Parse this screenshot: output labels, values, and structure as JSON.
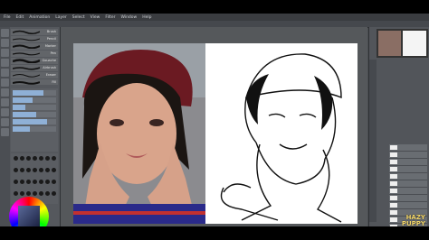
{
  "app": {
    "menu": [
      "File",
      "Edit",
      "Animation",
      "Layer",
      "Select",
      "View",
      "Filter",
      "Window",
      "Help"
    ]
  },
  "brushes": {
    "items": [
      "Brush",
      "Pencil",
      "Marker",
      "Pen",
      "Gouache",
      "Airbrush",
      "Eraser",
      "Fill",
      "Text"
    ]
  },
  "tool_properties": {
    "levels": [
      0.7,
      0.45,
      0.3,
      0.55,
      0.8,
      0.4
    ]
  },
  "canvas": {
    "left_image": "photo-reference",
    "right_image": "line-art-drawing"
  },
  "watermark": {
    "line1": "HAZY",
    "line2": "PUPPY"
  },
  "colors": {
    "ui_dark": "#4a4d52",
    "accent": "#8fb0d6"
  }
}
